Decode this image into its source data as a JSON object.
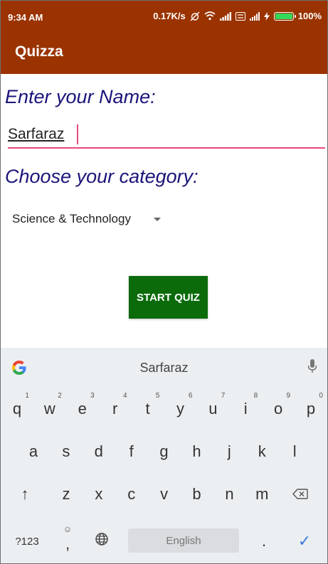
{
  "status_bar": {
    "time": "9:34 AM",
    "net_speed": "0.17K/s",
    "battery_percent_text": "100%",
    "battery_level": 1.0,
    "battery_color": "#33d95a"
  },
  "app_bar": {
    "title": "Quizza",
    "color": "#9a3300"
  },
  "form": {
    "name_label": "Enter your Name:",
    "name_value": "Sarfaraz",
    "category_label": "Choose your category:",
    "category_selected": "Science & Technology",
    "start_button": "START QUIZ",
    "label_color": "#1a147a",
    "button_color": "#0b6b0b",
    "input_underline_color": "#e84a7e"
  },
  "keyboard": {
    "suggestion": "Sarfaraz",
    "row1": [
      {
        "key": "q",
        "hint": "1"
      },
      {
        "key": "w",
        "hint": "2"
      },
      {
        "key": "e",
        "hint": "3"
      },
      {
        "key": "r",
        "hint": "4"
      },
      {
        "key": "t",
        "hint": "5"
      },
      {
        "key": "y",
        "hint": "6"
      },
      {
        "key": "u",
        "hint": "7"
      },
      {
        "key": "i",
        "hint": "8"
      },
      {
        "key": "o",
        "hint": "9"
      },
      {
        "key": "p",
        "hint": "0"
      }
    ],
    "row2": [
      "a",
      "s",
      "d",
      "f",
      "g",
      "h",
      "j",
      "k",
      "l"
    ],
    "row3": [
      "z",
      "x",
      "c",
      "v",
      "b",
      "n",
      "m"
    ],
    "shift_glyph": "↑",
    "symbols_key": "?123",
    "emoji_glyph": "☺",
    "comma_key": ",",
    "space_label": "English",
    "period_key": ".",
    "done_glyph": "✓"
  }
}
